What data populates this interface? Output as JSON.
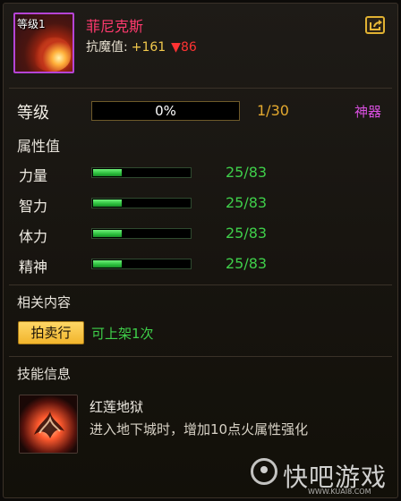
{
  "header": {
    "level_tag": "等级1",
    "name": "菲尼克斯",
    "resist_label": "抗魔值:",
    "resist_up": "+161",
    "resist_down": "▼86"
  },
  "level": {
    "label": "等级",
    "progress_text": "0%",
    "progress": 0,
    "count": "1/30",
    "type": "神器"
  },
  "attributes": {
    "title": "属性值",
    "items": [
      {
        "name": "力量",
        "value": "25/83",
        "fill": 0.3
      },
      {
        "name": "智力",
        "value": "25/83",
        "fill": 0.3
      },
      {
        "name": "体力",
        "value": "25/83",
        "fill": 0.3
      },
      {
        "name": "精神",
        "value": "25/83",
        "fill": 0.3
      }
    ]
  },
  "related": {
    "title": "相关内容",
    "auction_label": "拍卖行",
    "listable_text": "可上架1次"
  },
  "skill": {
    "title": "技能信息",
    "name": "红莲地狱",
    "description": "进入地下城时，增加10点火属性强化"
  },
  "watermark": {
    "text": "快吧游戏",
    "url": "WWW.KUAI8.COM"
  },
  "colors": {
    "title": "#ff3a6e",
    "rarity_border": "#b544d6",
    "stat_value": "#3fcf4a",
    "level_count": "#e4a92f",
    "artifact": "#d94fe0",
    "button": "#f1b52c"
  },
  "icons": [
    "share-icon",
    "phoenix-avatar-icon",
    "fire-skill-icon",
    "watermark-logo-icon"
  ]
}
